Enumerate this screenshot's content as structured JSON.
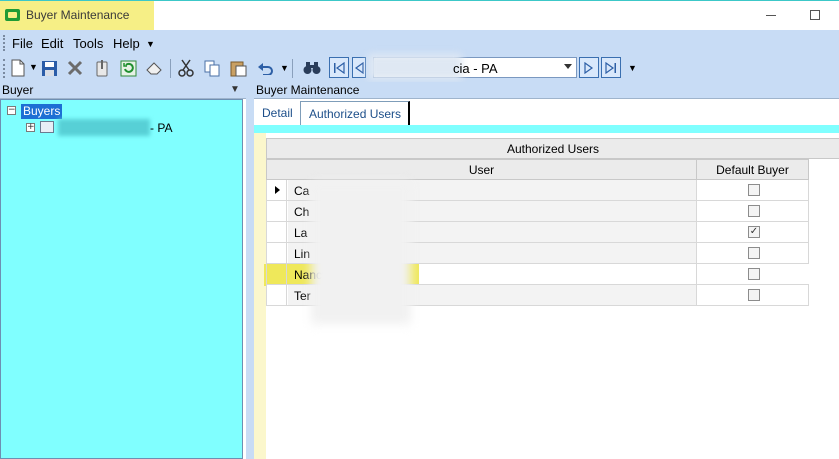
{
  "window": {
    "title": "Buyer Maintenance"
  },
  "menu": {
    "items": [
      "File",
      "Edit",
      "Tools",
      "Help"
    ]
  },
  "toolbar": {
    "icons": [
      "new-doc-icon",
      "save-icon",
      "delete-icon",
      "attach-icon",
      "refresh-icon",
      "eraser-icon",
      "cut-icon",
      "copy-icon",
      "paste-icon",
      "undo-icon",
      "binoculars-icon"
    ],
    "record_combo_value": "cia - PA",
    "nav": [
      "first-record",
      "previous-record",
      "next-record",
      "last-record"
    ]
  },
  "left_pane": {
    "header": "Buyer",
    "tree": {
      "root": "Buyers",
      "child_suffix": "- PA"
    }
  },
  "right_pane": {
    "header": "Buyer Maintenance",
    "tabs": [
      {
        "label": "Detail"
      },
      {
        "label": "Authorized Users"
      }
    ],
    "active_tab": "Authorized Users",
    "grid": {
      "caption": "Authorized Users",
      "columns": [
        "User",
        "Default Buyer"
      ],
      "rows": [
        {
          "user": "Ca",
          "default": false,
          "current": true
        },
        {
          "user": "Ch",
          "default": false
        },
        {
          "user": "La",
          "default": true
        },
        {
          "user": "Lin",
          "default": false
        },
        {
          "user": "Nancy Hoyt",
          "default": false,
          "highlighted": true
        },
        {
          "user": "Ter",
          "default": false
        }
      ]
    }
  },
  "colors": {
    "highlight": "#f6ef86",
    "pane_bg": "#80ffff",
    "chrome": "#c8dcf5",
    "selection": "#1d6fd4"
  }
}
